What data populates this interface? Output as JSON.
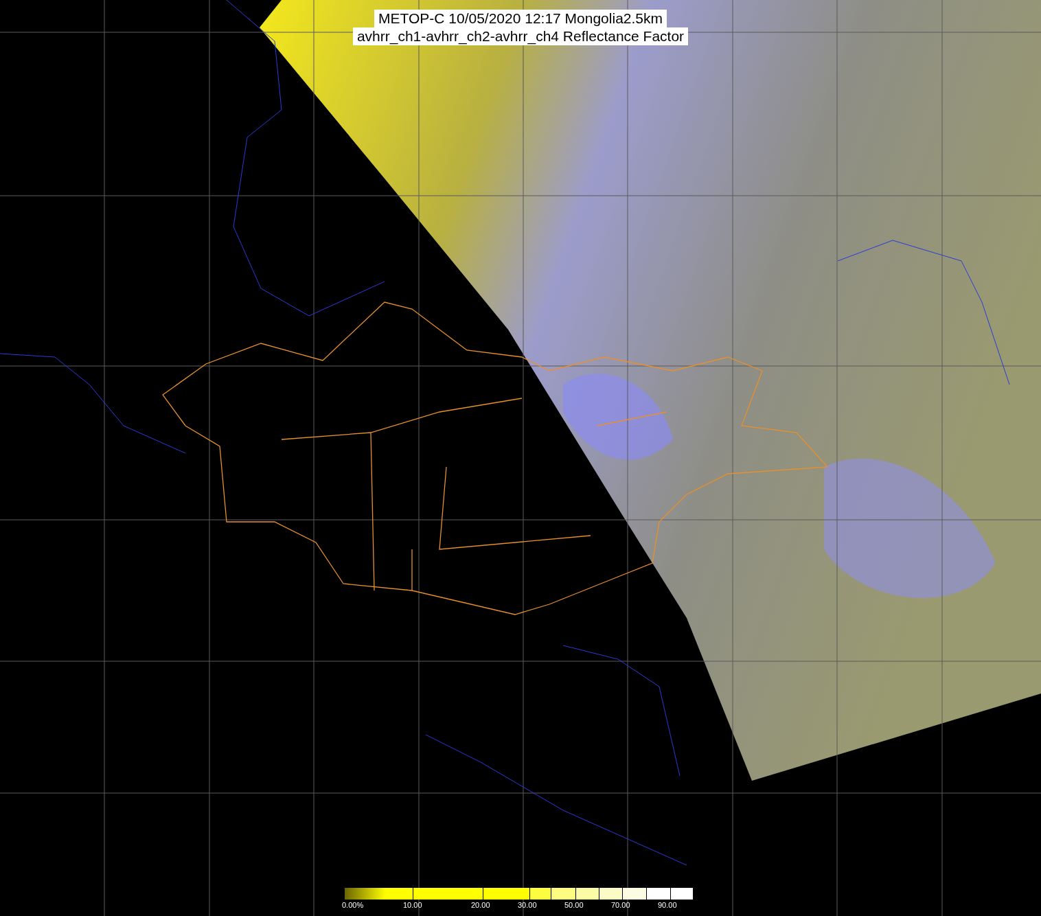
{
  "title": {
    "lines": [
      "METOP-C 10/05/2020 12:17 Mongolia2.5km",
      "avhrr_ch1-avhrr_ch2-avhrr_ch4 Reflectance Factor"
    ]
  },
  "colorbar": {
    "segments": [
      {
        "color": "#ffff00"
      },
      {
        "color": "#ffff00"
      },
      {
        "color": "#ffff00"
      },
      {
        "color": "#fdfd40"
      },
      {
        "color": "#fcfc80"
      },
      {
        "color": "#fbfba6"
      },
      {
        "color": "#fbfbc6"
      },
      {
        "color": "#fcfce2"
      },
      {
        "color": "#ffffff"
      },
      {
        "color": "#ffffff"
      }
    ],
    "labels": [
      "0.00%",
      "10.00",
      "20.00",
      "30.00",
      "50.00",
      "70.00",
      "90.00"
    ]
  }
}
